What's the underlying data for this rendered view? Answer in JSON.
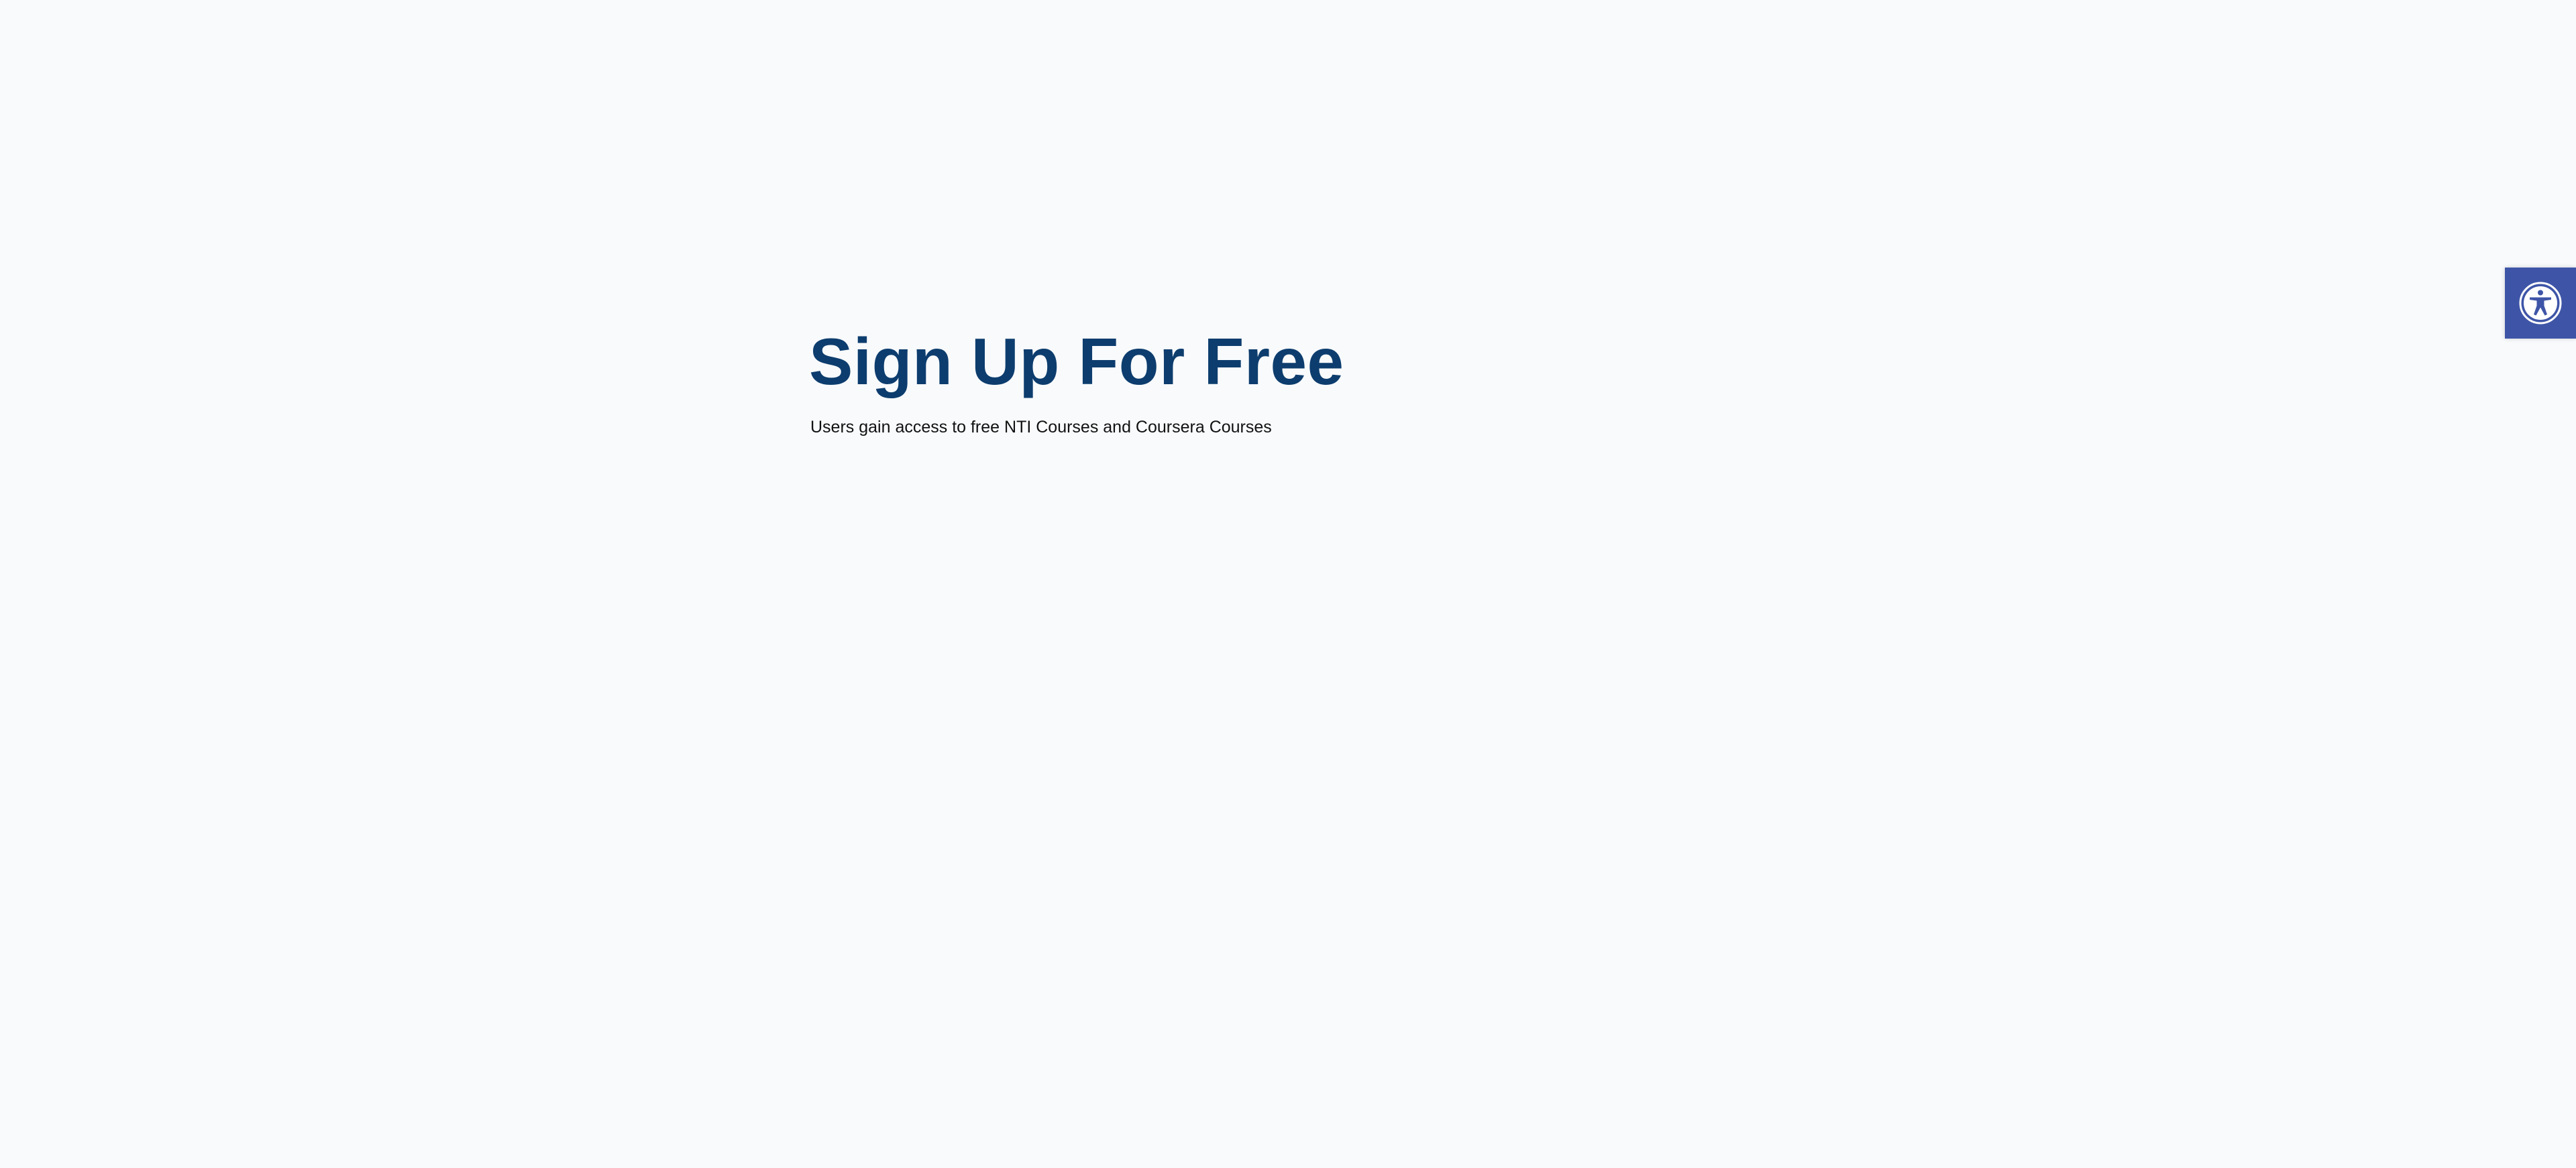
{
  "hero": {
    "title": "Sign Up For Free",
    "subtitle": "Users gain access to free NTI Courses and Coursera Courses"
  },
  "accessibility": {
    "icon": "accessibility-icon",
    "color": "#3e55a7"
  },
  "colors": {
    "background": "#f8fafc",
    "title": "#0d3d6e",
    "text": "#111111"
  }
}
